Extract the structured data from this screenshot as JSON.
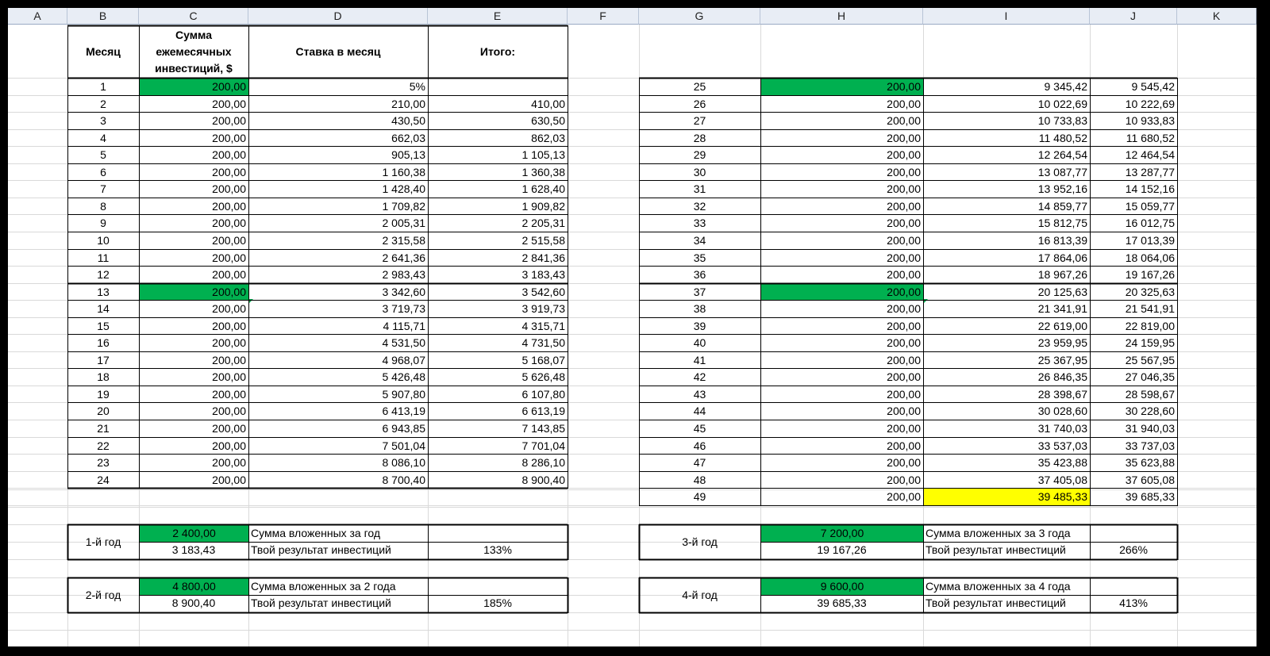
{
  "column_headers": [
    "A",
    "B",
    "C",
    "D",
    "E",
    "F",
    "G",
    "H",
    "I",
    "J",
    "K"
  ],
  "left_table": {
    "headers": {
      "month": "Месяц",
      "investment": "Сумма ежемесячных инвестиций, $",
      "rate": "Ставка в месяц",
      "total": "Итого:"
    },
    "rows": [
      [
        "1",
        "200,00",
        "5%",
        ""
      ],
      [
        "2",
        "200,00",
        "210,00",
        "410,00"
      ],
      [
        "3",
        "200,00",
        "430,50",
        "630,50"
      ],
      [
        "4",
        "200,00",
        "662,03",
        "862,03"
      ],
      [
        "5",
        "200,00",
        "905,13",
        "1 105,13"
      ],
      [
        "6",
        "200,00",
        "1 160,38",
        "1 360,38"
      ],
      [
        "7",
        "200,00",
        "1 428,40",
        "1 628,40"
      ],
      [
        "8",
        "200,00",
        "1 709,82",
        "1 909,82"
      ],
      [
        "9",
        "200,00",
        "2 005,31",
        "2 205,31"
      ],
      [
        "10",
        "200,00",
        "2 315,58",
        "2 515,58"
      ],
      [
        "11",
        "200,00",
        "2 641,36",
        "2 841,36"
      ],
      [
        "12",
        "200,00",
        "2 983,43",
        "3 183,43"
      ],
      [
        "13",
        "200,00",
        "3 342,60",
        "3 542,60"
      ],
      [
        "14",
        "200,00",
        "3 719,73",
        "3 919,73"
      ],
      [
        "15",
        "200,00",
        "4 115,71",
        "4 315,71"
      ],
      [
        "16",
        "200,00",
        "4 531,50",
        "4 731,50"
      ],
      [
        "17",
        "200,00",
        "4 968,07",
        "5 168,07"
      ],
      [
        "18",
        "200,00",
        "5 426,48",
        "5 626,48"
      ],
      [
        "19",
        "200,00",
        "5 907,80",
        "6 107,80"
      ],
      [
        "20",
        "200,00",
        "6 413,19",
        "6 613,19"
      ],
      [
        "21",
        "200,00",
        "6 943,85",
        "7 143,85"
      ],
      [
        "22",
        "200,00",
        "7 501,04",
        "7 701,04"
      ],
      [
        "23",
        "200,00",
        "8 086,10",
        "8 286,10"
      ],
      [
        "24",
        "200,00",
        "8 700,40",
        "8 900,40"
      ]
    ]
  },
  "right_table": {
    "rows": [
      [
        "25",
        "200,00",
        "9 345,42",
        "9 545,42"
      ],
      [
        "26",
        "200,00",
        "10 022,69",
        "10 222,69"
      ],
      [
        "27",
        "200,00",
        "10 733,83",
        "10 933,83"
      ],
      [
        "28",
        "200,00",
        "11 480,52",
        "11 680,52"
      ],
      [
        "29",
        "200,00",
        "12 264,54",
        "12 464,54"
      ],
      [
        "30",
        "200,00",
        "13 087,77",
        "13 287,77"
      ],
      [
        "31",
        "200,00",
        "13 952,16",
        "14 152,16"
      ],
      [
        "32",
        "200,00",
        "14 859,77",
        "15 059,77"
      ],
      [
        "33",
        "200,00",
        "15 812,75",
        "16 012,75"
      ],
      [
        "34",
        "200,00",
        "16 813,39",
        "17 013,39"
      ],
      [
        "35",
        "200,00",
        "17 864,06",
        "18 064,06"
      ],
      [
        "36",
        "200,00",
        "18 967,26",
        "19 167,26"
      ],
      [
        "37",
        "200,00",
        "20 125,63",
        "20 325,63"
      ],
      [
        "38",
        "200,00",
        "21 341,91",
        "21 541,91"
      ],
      [
        "39",
        "200,00",
        "22 619,00",
        "22 819,00"
      ],
      [
        "40",
        "200,00",
        "23 959,95",
        "24 159,95"
      ],
      [
        "41",
        "200,00",
        "25 367,95",
        "25 567,95"
      ],
      [
        "42",
        "200,00",
        "26 846,35",
        "27 046,35"
      ],
      [
        "43",
        "200,00",
        "28 398,67",
        "28 598,67"
      ],
      [
        "44",
        "200,00",
        "30 028,60",
        "30 228,60"
      ],
      [
        "45",
        "200,00",
        "31 740,03",
        "31 940,03"
      ],
      [
        "46",
        "200,00",
        "33 537,03",
        "33 737,03"
      ],
      [
        "47",
        "200,00",
        "35 423,88",
        "35 623,88"
      ],
      [
        "48",
        "200,00",
        "37 405,08",
        "37 605,08"
      ],
      [
        "49",
        "200,00",
        "39 485,33",
        "39 685,33"
      ]
    ]
  },
  "summaries": [
    {
      "year": "1-й год",
      "invested": "2 400,00",
      "invested_label": "Сумма вложенных за год",
      "result": "3 183,43",
      "result_label": "Твой результат инвестиций",
      "percent": "133%"
    },
    {
      "year": "2-й год",
      "invested": "4 800,00",
      "invested_label": "Сумма вложенных за 2 года",
      "result": "8 900,40",
      "result_label": "Твой результат инвестиций",
      "percent": "185%"
    },
    {
      "year": "3-й год",
      "invested": "7 200,00",
      "invested_label": "Сумма вложенных за 3 года",
      "result": "19 167,26",
      "result_label": "Твой результат инвестиций",
      "percent": "266%"
    },
    {
      "year": "4-й год",
      "invested": "9 600,00",
      "invested_label": "Сумма вложенных за 4 года",
      "result": "39 685,33",
      "result_label": "Твой результат инвестиций",
      "percent": "413%"
    }
  ],
  "colors": {
    "green_fill": "#00b050",
    "yellow_fill": "#ffff00",
    "header_bg": "#e8edf5",
    "gridline": "#d9d9d9"
  }
}
